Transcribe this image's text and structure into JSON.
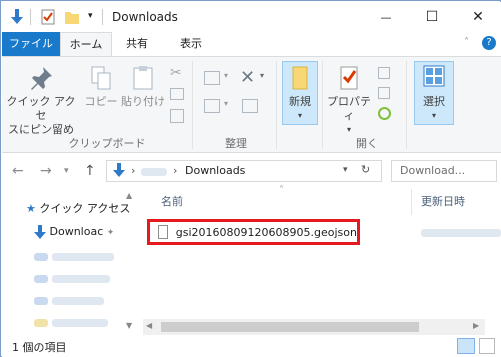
{
  "window": {
    "title": "Downloads",
    "minimize_glyph": "—",
    "maximize_glyph": "☐",
    "close_glyph": "✕"
  },
  "ribbon_tabs": [
    "ファイル",
    "ホーム",
    "共有",
    "表示"
  ],
  "ribbon": {
    "pin_label_1": "クイック アクセ",
    "pin_label_2": "スにピン留め",
    "copy_label": "コピー",
    "paste_label": "貼り付け",
    "group_clipboard": "クリップボード",
    "group_organize": "整理",
    "new_label": "新規",
    "properties_label": "プロパティ",
    "group_open": "開く",
    "select_label": "選択"
  },
  "address_bar": {
    "crumb": "Downloads",
    "search_placeholder": "Download..."
  },
  "nav_pane": {
    "quick_access": "クイック アクセス",
    "downloads": "Downloac"
  },
  "columns": {
    "name": "名前",
    "modified": "更新日時"
  },
  "files": [
    {
      "name": "gsi20160809120608905.geojson"
    }
  ],
  "status_bar": {
    "item_count": "1 個の項目"
  },
  "colors": {
    "accent": "#1979ca",
    "highlight_box": "#e5191f",
    "selection": "#cde8fb"
  }
}
